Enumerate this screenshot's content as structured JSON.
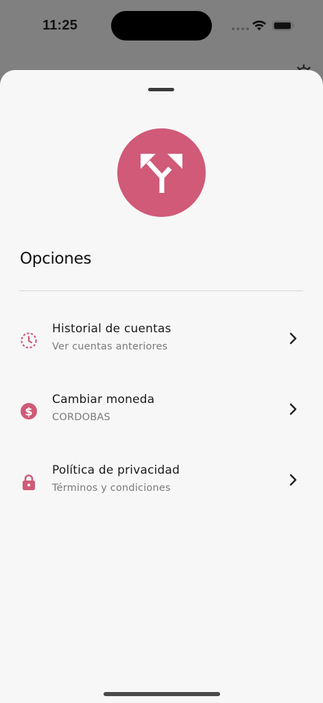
{
  "status_bar": {
    "time": "11:25",
    "icons": [
      "signal-dots-icon",
      "wifi-icon",
      "battery-icon"
    ]
  },
  "background": {
    "icon": "gear-icon"
  },
  "sheet": {
    "hero_icon": "split-arrows-icon",
    "title": "Opciones",
    "accent_color": "#d05a78",
    "items": [
      {
        "icon": "clock-history-icon",
        "title": "Historial de cuentas",
        "subtitle": "Ver cuentas anteriores"
      },
      {
        "icon": "dollar-circle-icon",
        "title": "Cambiar moneda",
        "subtitle": "CORDOBAS"
      },
      {
        "icon": "lock-icon",
        "title": "Política de privacidad",
        "subtitle": "Términos y condiciones"
      }
    ]
  }
}
